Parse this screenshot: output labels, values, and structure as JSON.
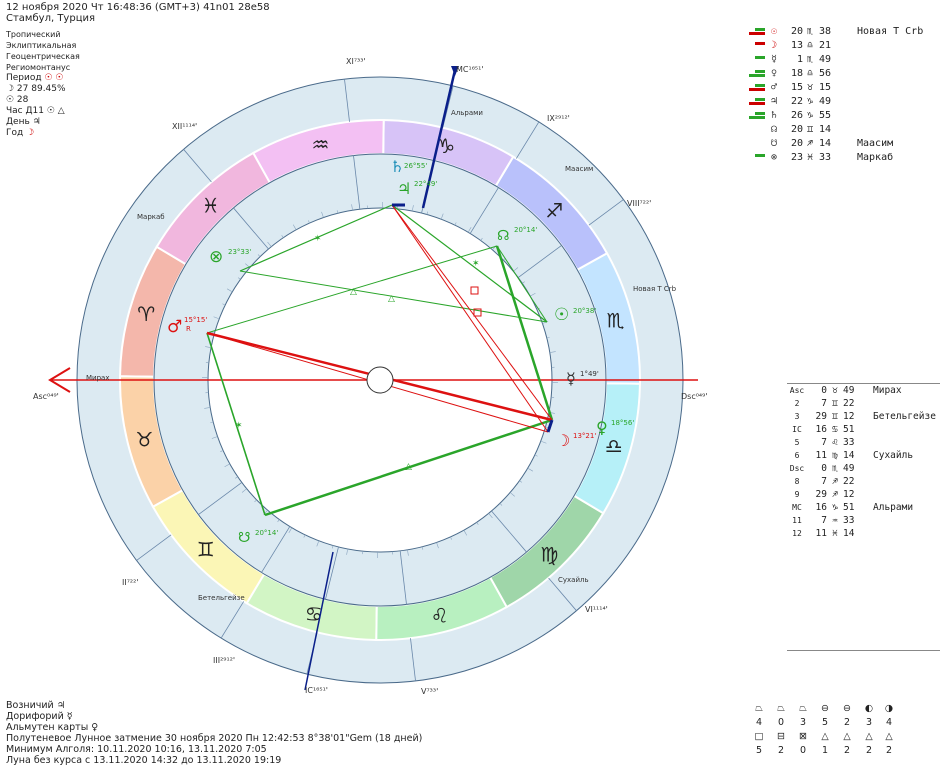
{
  "header": {
    "line": "12 ноября 2020  Чт  16:48:36 (GMT+3) 41n01  28e58",
    "location": "Стамбул, Турция"
  },
  "settings": {
    "zodiac": "Тропический",
    "coords": "Эклиптикальная",
    "center": "Геоцентрическая",
    "houses": "Региомонтанус",
    "period_label": "Период",
    "period_value": "☉ ☉",
    "moon_line": "☽  27 89.45%",
    "sun_line": "☉  28",
    "hour_label": "Час Д11",
    "hour_value": "☉ △",
    "day_label": "День",
    "day_value": "♃",
    "year_label": "Год",
    "year_value": "☽"
  },
  "planets": [
    {
      "glyph": "☉",
      "color": "#cc0000",
      "deg": "20",
      "sign": "♏",
      "min": "38",
      "star": "Новая Т Crb"
    },
    {
      "glyph": "☽",
      "color": "#cc0000",
      "deg": "13",
      "sign": "♎",
      "min": "21",
      "star": ""
    },
    {
      "glyph": "☿",
      "color": "#333333",
      "deg": "1",
      "sign": "♏",
      "min": "49",
      "star": ""
    },
    {
      "glyph": "♀",
      "color": "#333333",
      "deg": "18",
      "sign": "♎",
      "min": "56",
      "star": ""
    },
    {
      "glyph": "♂",
      "color": "#333333",
      "deg": "15",
      "sign": "♉",
      "min": "15",
      "star": ""
    },
    {
      "glyph": "♃",
      "color": "#333333",
      "deg": "22",
      "sign": "♑",
      "min": "49",
      "star": ""
    },
    {
      "glyph": "♄",
      "color": "#333333",
      "deg": "26",
      "sign": "♑",
      "min": "55",
      "star": ""
    },
    {
      "glyph": "☊",
      "color": "#333333",
      "deg": "20",
      "sign": "♊",
      "min": "14",
      "star": ""
    },
    {
      "glyph": "☋",
      "color": "#333333",
      "deg": "20",
      "sign": "♐",
      "min": "14",
      "star": "Маасим"
    },
    {
      "glyph": "⊗",
      "color": "#333333",
      "deg": "23",
      "sign": "♓",
      "min": "33",
      "star": "Маркаб"
    }
  ],
  "houses": [
    {
      "label": "Asc",
      "deg": "0",
      "sign": "♉",
      "min": "49",
      "star": "Мирах"
    },
    {
      "label": "2",
      "deg": "7",
      "sign": "♊",
      "min": "22",
      "star": ""
    },
    {
      "label": "3",
      "deg": "29",
      "sign": "♊",
      "min": "12",
      "star": "Бетельгейзе"
    },
    {
      "label": "IC",
      "deg": "16",
      "sign": "♋",
      "min": "51",
      "star": ""
    },
    {
      "label": "5",
      "deg": "7",
      "sign": "♌",
      "min": "33",
      "star": ""
    },
    {
      "label": "6",
      "deg": "11",
      "sign": "♍",
      "min": "14",
      "star": "Сухайль"
    },
    {
      "label": "Dsc",
      "deg": "0",
      "sign": "♏",
      "min": "49",
      "star": ""
    },
    {
      "label": "8",
      "deg": "7",
      "sign": "♐",
      "min": "22",
      "star": ""
    },
    {
      "label": "9",
      "deg": "29",
      "sign": "♐",
      "min": "12",
      "star": ""
    },
    {
      "label": "MC",
      "deg": "16",
      "sign": "♑",
      "min": "51",
      "star": "Альрами"
    },
    {
      "label": "11",
      "deg": "7",
      "sign": "♒",
      "min": "33",
      "star": ""
    },
    {
      "label": "12",
      "deg": "11",
      "sign": "♓",
      "min": "14",
      "star": ""
    }
  ],
  "chart_labels": {
    "asc": "Asc⁰⁴⁹'",
    "dsc": "Dsc⁰⁴⁹'",
    "mc": "MC¹⁶⁵¹'",
    "ic": "IC¹⁶⁵¹'",
    "h2": "II⁷²²'",
    "h3": "III²⁹¹²'",
    "h5": "V⁷³³'",
    "h6": "VI¹¹¹⁴'",
    "h8": "VIII⁷²²'",
    "h9": "IX²⁹¹²'",
    "h11": "XI⁷³³'",
    "h12": "XII¹¹¹⁴'",
    "star_mirah": "Мирах",
    "star_markab": "Маркаб",
    "star_alrami": "Альрами",
    "star_maasim": "Маасим",
    "star_novaya": "Новая Т Crb",
    "star_suhail": "Сухайль",
    "star_betelgeuse": "Бетельгейзе",
    "pl_saturn": "26°55'",
    "pl_jupiter": "22°49'",
    "pl_venus_n": "20°14'",
    "pl_sun": "20°38'",
    "pl_mercury": "1°49'",
    "pl_venus": "18°56'",
    "pl_moon": "13°21'",
    "pl_node_s": "20°14'",
    "pl_mars": "15°15'",
    "pl_mars_r": "R",
    "pl_fortune": "23°33'"
  },
  "footer": {
    "voznichiy": "Возничий  ♃",
    "doriforiy": "Дорифорий  ☿",
    "almuten": "Альмутен карты  ♀",
    "eclipse": "Полутеневое Лунное затмение 30 ноября 2020 Пн 12:42:53  8°38'01\"Gem (18 дней)",
    "algol": "Минимум Алголя: 10.11.2020 10:16,  13.11.2020  7:05",
    "moon_void": "Луна без курса с 13.11.2020 14:32 до 13.11.2020 19:19"
  },
  "stats": {
    "row1_icons": [
      "⏢",
      "⏢",
      "⏢",
      "⊖",
      "⊖",
      "◐",
      "◑"
    ],
    "row1_vals": [
      "4",
      "0",
      "3",
      "5",
      "2",
      "3",
      "4"
    ],
    "row2_icons": [
      "□",
      "⊟",
      "⊠",
      "△",
      "△",
      "△",
      "△"
    ],
    "row2_vals": [
      "5",
      "2",
      "0",
      "1",
      "2",
      "2",
      "2"
    ]
  }
}
